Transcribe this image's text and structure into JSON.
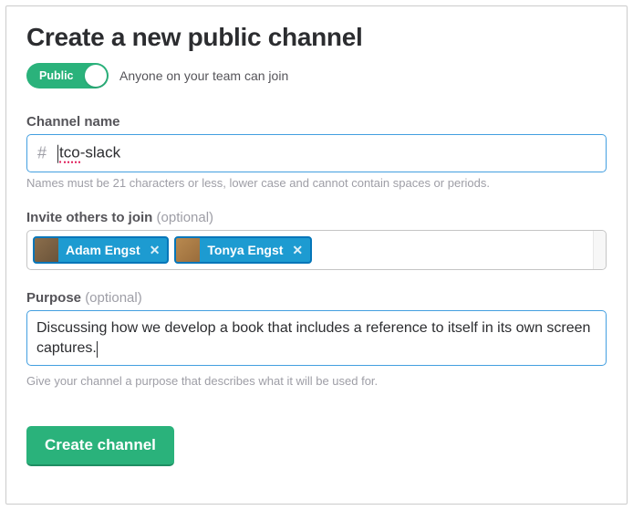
{
  "title": "Create a new public channel",
  "toggle": {
    "label": "Public",
    "description": "Anyone on your team can join"
  },
  "channel_name": {
    "label": "Channel name",
    "value_misspelled": "tco",
    "value_rest": "-slack",
    "help": "Names must be 21 characters or less, lower case and cannot contain spaces or periods."
  },
  "invite": {
    "label": "Invite others to join ",
    "optional": "(optional)",
    "chips": [
      {
        "name": "Adam Engst"
      },
      {
        "name": "Tonya Engst"
      }
    ]
  },
  "purpose": {
    "label": "Purpose ",
    "optional": "(optional)",
    "value": "Discussing how we develop a book that includes a reference to itself in its own screen captures.",
    "help": "Give your channel a purpose that describes what it will be used for."
  },
  "submit": {
    "label": "Create channel"
  },
  "colors": {
    "accent_green": "#2ab27b",
    "accent_blue": "#439fe0",
    "chip_blue": "#1d9bd1"
  }
}
